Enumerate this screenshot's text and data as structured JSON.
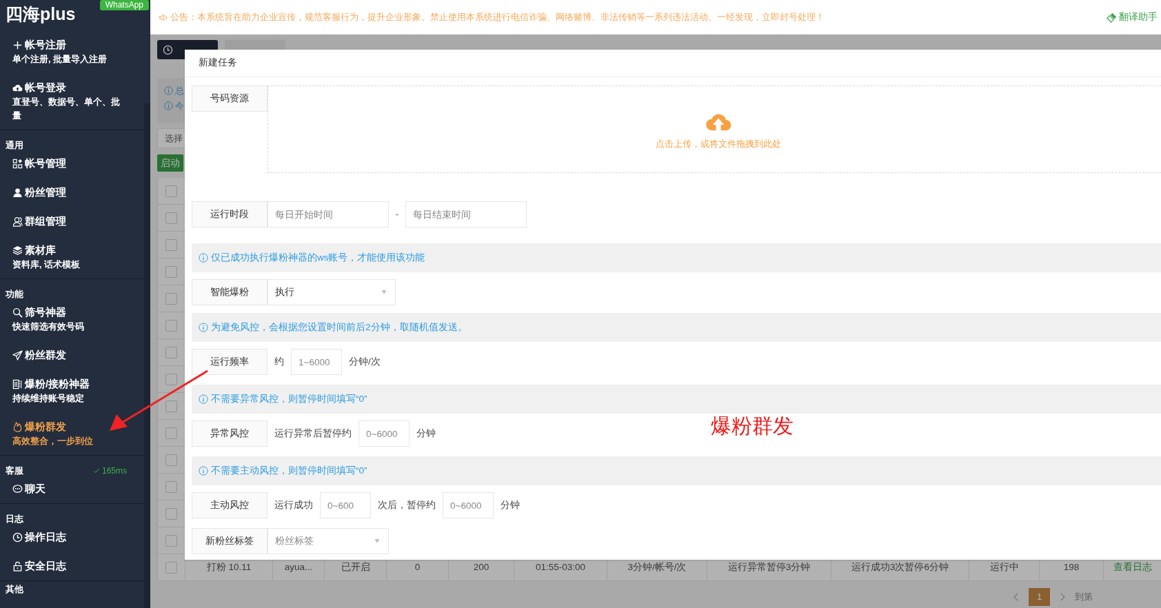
{
  "sidebar": {
    "logo": "四海plus",
    "badge": "WhatsApp",
    "groups": [
      {
        "items": [
          {
            "label": "帐号注册",
            "sub": "单个注册, 批量导入注册",
            "selected": false
          },
          {
            "label": "帐号登录",
            "sub": "直登号、数据号、单个、批量",
            "selected": false
          }
        ]
      },
      {
        "title": "通用",
        "items": [
          {
            "label": "帐号管理",
            "selected": false
          },
          {
            "label": "粉丝管理",
            "selected": false
          },
          {
            "label": "群组管理",
            "selected": false
          },
          {
            "label": "素材库",
            "sub": "资料库, 话术模板",
            "selected": false
          }
        ]
      },
      {
        "title": "功能",
        "items": [
          {
            "label": "筛号神器",
            "sub": "快速筛选有效号码",
            "selected": false
          },
          {
            "label": "粉丝群发",
            "selected": false
          },
          {
            "label": "爆粉/接粉神器",
            "sub": "持续维持账号稳定",
            "selected": false
          },
          {
            "label": "爆粉群发",
            "sub": "高效整合，一步到位",
            "selected": true
          }
        ]
      },
      {
        "title": "客服",
        "status": "165ms",
        "items": [
          {
            "label": "聊天",
            "selected": false
          }
        ]
      },
      {
        "title": "日志",
        "items": [
          {
            "label": "操作日志",
            "selected": false
          },
          {
            "label": "安全日志",
            "selected": false
          }
        ]
      },
      {
        "title": "其他"
      }
    ]
  },
  "topbar": {
    "notice": "公告：本系统旨在助力企业宣传，规范客服行为，提升企业形象。禁止使用本系统进行电信诈骗、网络赌博、非法传销等一系列违法活动。一经发现，立即封号处理！",
    "translate": "翻译助手"
  },
  "background": {
    "tabs": [
      {
        "selected": true
      },
      {
        "selected": false
      }
    ],
    "info_lines": [
      "总",
      "今"
    ],
    "filter": "选择",
    "start_button": "启动",
    "table": {
      "rows": [
        {
          "checked": false
        },
        {
          "checked": false
        },
        {
          "checked": false
        },
        {
          "checked": false
        },
        {
          "checked": false
        },
        {
          "checked": false
        },
        {
          "checked": false
        },
        {
          "checked": false
        },
        {
          "checked": false
        },
        {
          "checked": false
        },
        {
          "checked": false
        },
        {
          "checked": false
        },
        {
          "checked": false
        },
        {
          "checked": false
        },
        {
          "checked": false,
          "cells": [
            "打粉 10.11",
            "ayua...",
            "已开启",
            "0",
            "200",
            "01:55-03:00",
            "3分钟/帐号/次",
            "运行异常暂停3分钟",
            "运行成功3次暂停6分钟",
            "运行中",
            "198",
            "查看日志"
          ]
        }
      ]
    },
    "pagination": {
      "pages": [
        {
          "label": "1",
          "selected": true
        }
      ],
      "goto": "到第"
    }
  },
  "modal": {
    "title": "新建任务",
    "rows": [
      {
        "kind": "upload",
        "label": "号码资源",
        "hint": "点击上传，或将文件拖拽到此处"
      },
      {
        "kind": "range",
        "label": "运行时段",
        "start_placeholder": "每日开始时间",
        "separator": "-",
        "end_placeholder": "每日结束时间"
      },
      {
        "kind": "info",
        "text": "仅已成功执行爆粉神器的ws账号，才能使用该功能"
      },
      {
        "kind": "select",
        "label": "智能爆粉",
        "value": "执行"
      },
      {
        "kind": "info",
        "text": "为避免风控，会根据您设置时间前后2分钟，取随机值发送。"
      },
      {
        "kind": "inline",
        "label": "运行频率",
        "parts": [
          {
            "kind": "text",
            "text": "约"
          },
          {
            "kind": "input",
            "placeholder": "1~6000"
          },
          {
            "kind": "text",
            "text": "分钟/次"
          }
        ]
      },
      {
        "kind": "info",
        "text": "不需要异常风控，则暂停时间填写“0”"
      },
      {
        "kind": "inline",
        "label": "异常风控",
        "parts": [
          {
            "kind": "text",
            "text": "运行异常后暂停约"
          },
          {
            "kind": "input",
            "placeholder": "0~6000"
          },
          {
            "kind": "text",
            "text": "分钟"
          }
        ]
      },
      {
        "kind": "info",
        "text": "不需要主动风控，则暂停时间填写“0”"
      },
      {
        "kind": "inline",
        "label": "主动风控",
        "parts": [
          {
            "kind": "text",
            "text": "运行成功"
          },
          {
            "kind": "input",
            "placeholder": "0~600"
          },
          {
            "kind": "text",
            "text": "次后，暂停约"
          },
          {
            "kind": "input",
            "placeholder": "0~6000"
          },
          {
            "kind": "text",
            "text": "分钟"
          }
        ]
      },
      {
        "kind": "select",
        "label": "新粉丝标签",
        "placeholder": "粉丝标签"
      }
    ]
  },
  "annotation": {
    "text": "爆粉群发"
  }
}
